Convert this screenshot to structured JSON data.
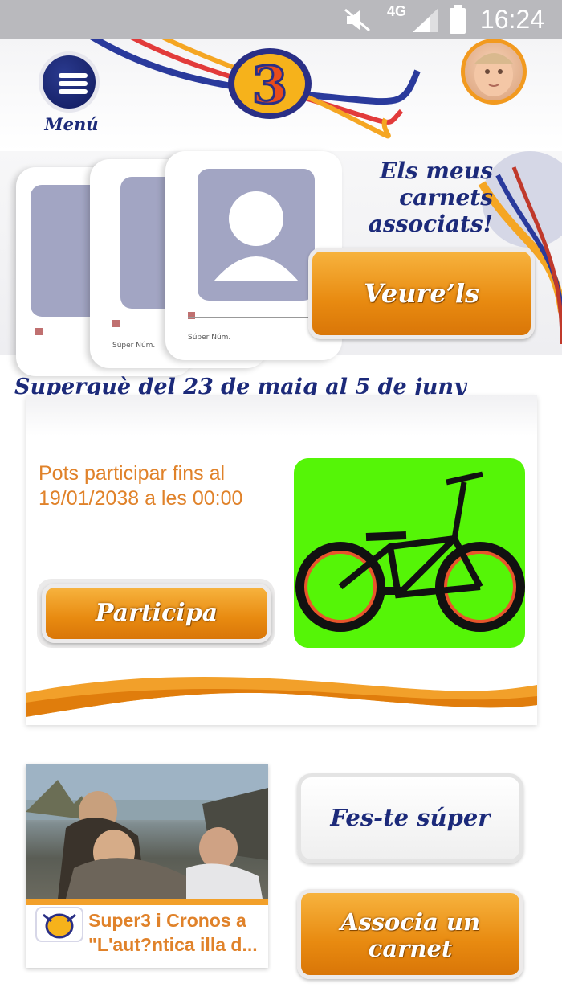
{
  "status_bar": {
    "network": "4G",
    "time": "16:24",
    "icons": [
      "mute-icon",
      "signal-icon",
      "battery-icon"
    ]
  },
  "header": {
    "menu_label": "Menú",
    "logo_text": "3"
  },
  "carnets": {
    "title_lines": [
      "Els meus",
      "carnets",
      "associats!"
    ],
    "view_button": "Veure’ls",
    "card_number_label": "Súper Núm."
  },
  "superque": {
    "title": "Superquè del 23 de maig al 5 de juny",
    "deadline_lines": [
      "Pots participar fins al",
      "19/01/2038 a les 00:00"
    ],
    "participate_button": "Participa",
    "prize_image": "bmx-bike"
  },
  "news": {
    "title_lines": [
      "Super3 i Cronos a",
      "\"L'aut?ntica illa d..."
    ]
  },
  "buttons": {
    "fes_te_super": "Fes-te súper",
    "associa_lines": [
      "Associa un",
      "carnet"
    ]
  },
  "colors": {
    "navy": "#1c2a7a",
    "orange": "#e88a10",
    "prize_bg": "#55f507",
    "deadline_text": "#e0822a"
  }
}
